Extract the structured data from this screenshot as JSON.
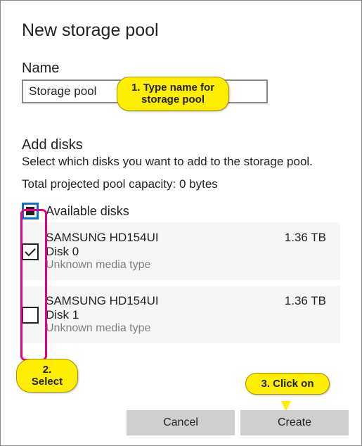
{
  "title": "New storage pool",
  "name_section": {
    "label": "Name",
    "value": "Storage pool"
  },
  "disks_section": {
    "heading": "Add disks",
    "help": "Select which disks you want to add to the storage pool.",
    "capacity_label": "Total projected pool capacity:",
    "capacity_value": "0 bytes",
    "group_label": "Available disks",
    "items": [
      {
        "model": "SAMSUNG HD154UI",
        "name": "Disk 0",
        "media": "Unknown media type",
        "size": "1.36 TB",
        "checked": true
      },
      {
        "model": "SAMSUNG HD154UI",
        "name": "Disk 1",
        "media": "Unknown media type",
        "size": "1.36 TB",
        "checked": false
      }
    ]
  },
  "buttons": {
    "cancel": "Cancel",
    "create": "Create"
  },
  "annotations": {
    "step1": "1. Type name for storage pool",
    "step2": "2. Select",
    "step3": "3. Click on"
  }
}
